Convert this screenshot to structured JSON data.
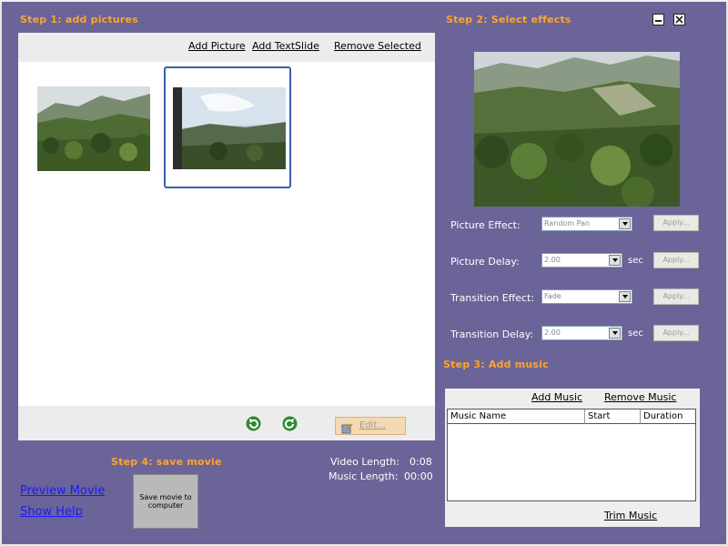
{
  "step1": {
    "title": "Step 1: add pictures",
    "add_picture": "Add Picture",
    "add_textslide": "Add TextSlide",
    "remove_selected": "Remove Selected",
    "edit_label": "Edit..."
  },
  "step2": {
    "title": "Step 2: Select effects",
    "picture_effect_label": "Picture Effect:",
    "picture_effect_value": "Random Pan",
    "picture_delay_label": "Picture Delay:",
    "picture_delay_value": "2.00",
    "transition_effect_label": "Transition Effect:",
    "transition_effect_value": "Fade",
    "transition_delay_label": "Transition Delay:",
    "transition_delay_value": "2.00",
    "sec_label": "sec",
    "apply_label": "Apply..."
  },
  "step3": {
    "title": "Step 3: Add music",
    "add_music": "Add Music",
    "remove_music": "Remove Music",
    "columns": [
      "Music Name",
      "Start",
      "Duration"
    ],
    "trim_music": "Trim Music"
  },
  "step4": {
    "title": "Step 4: save movie",
    "save_button": "Save movie to computer",
    "preview_movie": "Preview Movie",
    "show_help": "Show Help",
    "video_length_label": "Video Length:",
    "video_length_value": "0:08",
    "music_length_label": "Music Length:",
    "music_length_value": "00:00"
  },
  "colors": {
    "background": "#6a6498",
    "title_orange": "#ffa42b",
    "selection_border": "#3b5fb0"
  },
  "icons": [
    "rotate-left-icon",
    "rotate-right-icon",
    "edit-icon",
    "minimize-icon",
    "close-icon"
  ]
}
